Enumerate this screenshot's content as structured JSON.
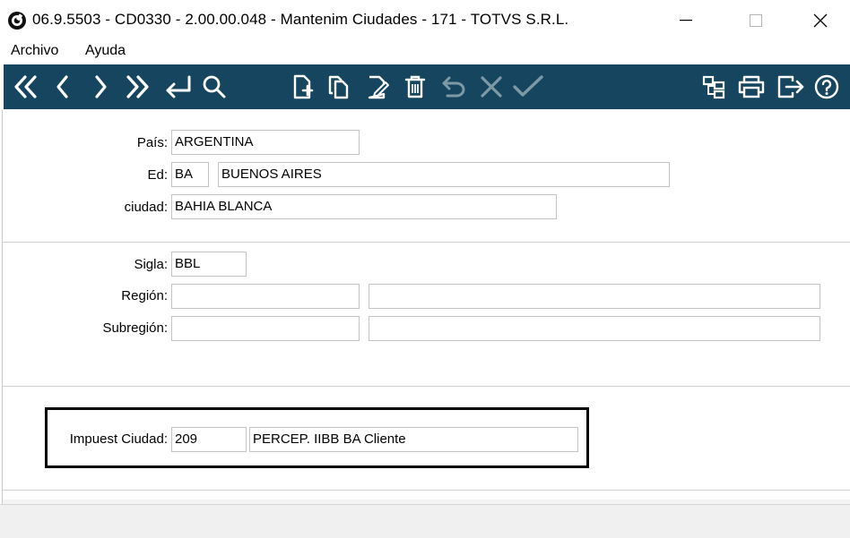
{
  "window": {
    "title": "06.9.5503 - CD0330 - 2.00.00.048 - Mantenim Ciudades - 171 - TOTVS S.R.L."
  },
  "menu": {
    "items": [
      "Archivo",
      "Ayuda"
    ]
  },
  "toolbar": {
    "nav_buttons": [
      "first-icon",
      "previous-icon",
      "next-icon",
      "last-icon",
      "goto-icon",
      "search-icon"
    ],
    "edit_buttons": [
      "add-icon",
      "copy-icon",
      "edit-icon",
      "delete-icon",
      "undo-icon",
      "cancel-icon",
      "confirm-icon"
    ],
    "right_buttons": [
      "tree-icon",
      "print-icon",
      "exit-icon",
      "help-icon"
    ],
    "background_color": "#16465f"
  },
  "form": {
    "pais": {
      "label": "País:",
      "value": "ARGENTINA"
    },
    "ed": {
      "label": "Ed:",
      "code": "BA",
      "name": "BUENOS AIRES"
    },
    "ciudad": {
      "label": "ciudad:",
      "value": "BAHIA BLANCA"
    },
    "sigla": {
      "label": "Sigla:",
      "value": "BBL"
    },
    "region": {
      "label": "Región:",
      "code": "",
      "name": ""
    },
    "subregion": {
      "label": "Subregión:",
      "code": "",
      "name": ""
    },
    "impuest_ciudad": {
      "label": "Impuest Ciudad:",
      "code": "209",
      "name": "PERCEP. IIBB BA Cliente"
    }
  }
}
